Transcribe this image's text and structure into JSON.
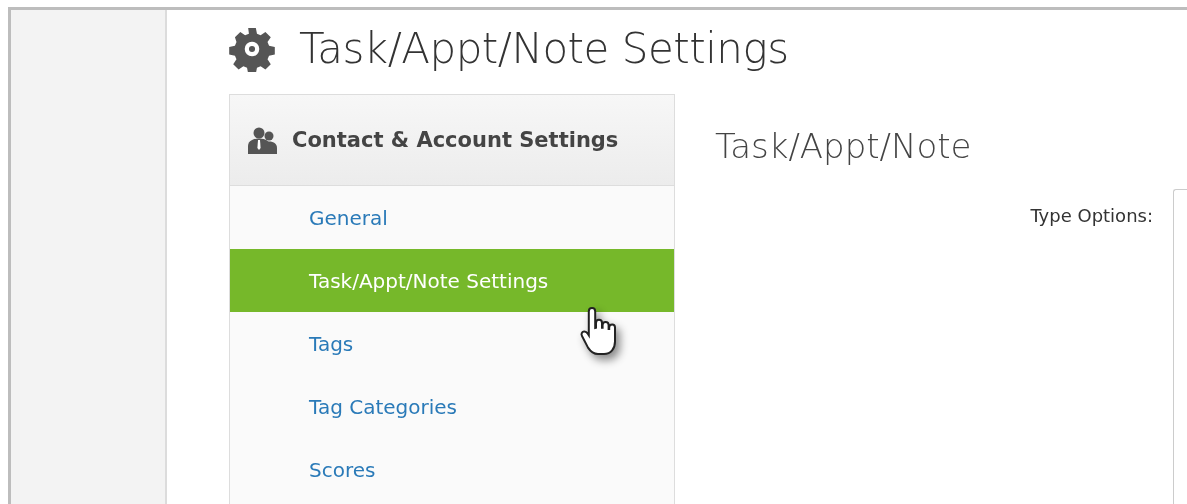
{
  "page": {
    "title": "Task/Appt/Note Settings"
  },
  "sidebar": {
    "header": "Contact & Account Settings",
    "items": [
      {
        "label": "General",
        "selected": false
      },
      {
        "label": "Task/Appt/Note Settings",
        "selected": true
      },
      {
        "label": "Tags",
        "selected": false
      },
      {
        "label": "Tag Categories",
        "selected": false
      },
      {
        "label": "Scores",
        "selected": false
      }
    ]
  },
  "content": {
    "heading": "Task/Appt/Note",
    "type_options_label": "Type Options:"
  }
}
